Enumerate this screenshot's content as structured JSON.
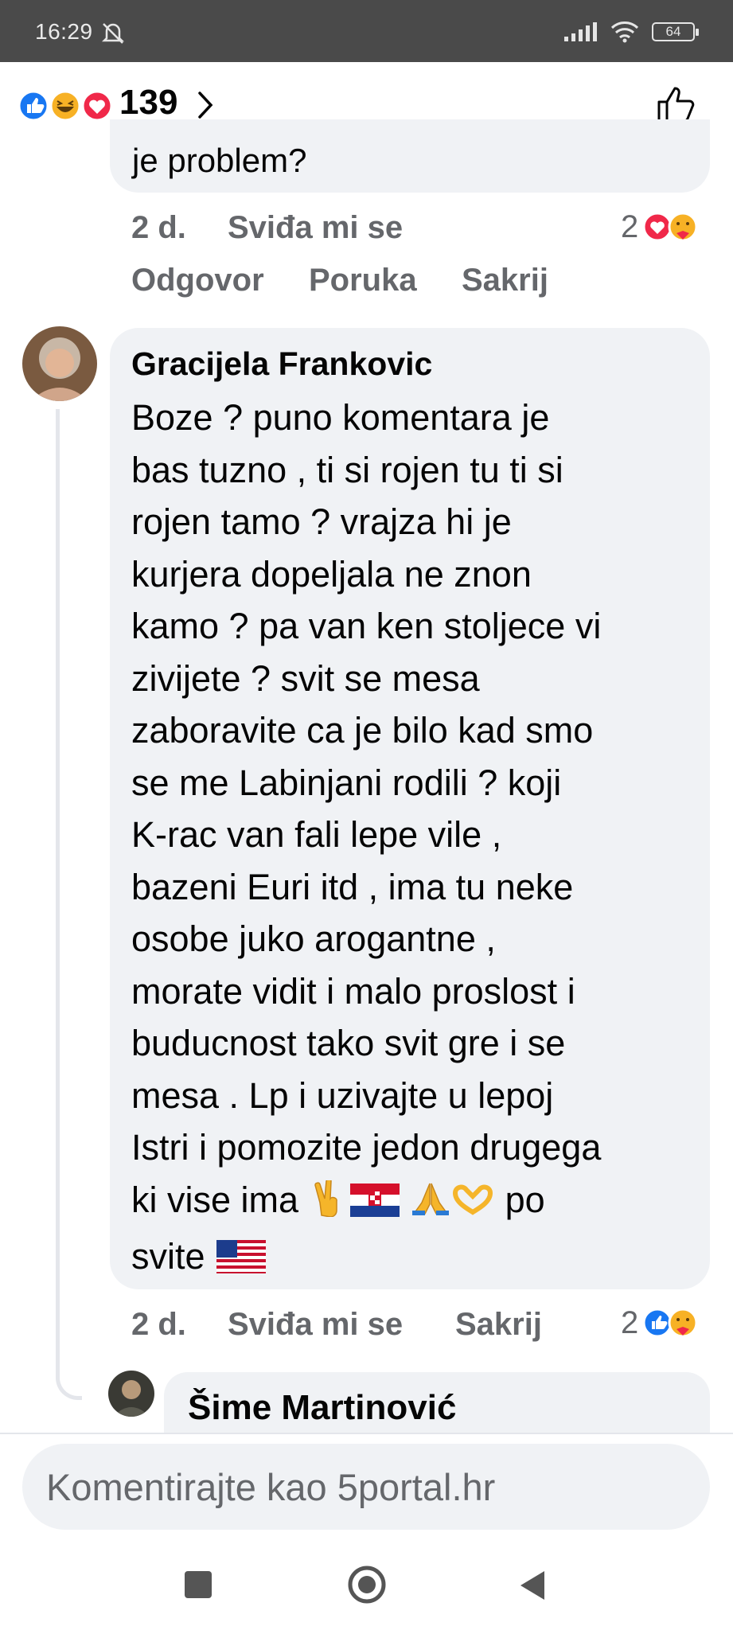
{
  "status_bar": {
    "time": "16:29",
    "battery": "64"
  },
  "reactions": {
    "count": "139",
    "icons": [
      "like-reaction",
      "haha-reaction",
      "love-reaction"
    ]
  },
  "comments": [
    {
      "text_tail": "je problem?",
      "time": "2 d.",
      "like_label": "Sviđa mi se",
      "reply_label": "Odgovor",
      "message_label": "Poruka",
      "hide_label": "Sakrij",
      "reaction_count": "2",
      "reaction_icons": [
        "love-reaction",
        "care-reaction"
      ]
    },
    {
      "author": "Gracijela Frankovic",
      "text_before_emoji": "Boze ? puno komentara je\nbas tuzno , ti si rojen tu ti si\nrojen  tamo ? vrajza hi je\nkurjera dopeljala ne znon\nkamo ? pa van ken stoljece vi\nzivijete ? svit se mesa\nzaboravite ca je bilo kad smo\nse me Labinjani rodili ? koji\nK-rac van fali lepe vile ,\nbazeni Euri itd , ima tu neke\nosobe juko arogantne ,\nmorate vidit i malo proslost i\nbuducnost tako svit gre i se\nmesa . Lp i uzivajte u lepoj\nIstri i pomozite jedon drugega\nki vise ima ",
      "text_middle": " po\nsvite ",
      "emojis": [
        "victory-hand",
        "croatia-flag",
        "folded-hands",
        "heart-hands",
        "usa-flag"
      ],
      "time": "2 d.",
      "like_label": "Sviđa mi se",
      "hide_label": "Sakrij",
      "reaction_count": "2",
      "reaction_icons": [
        "like-reaction",
        "care-reaction"
      ]
    },
    {
      "author": "Šime Martinović"
    }
  ],
  "composer": {
    "placeholder": "Komentirajte kao 5portal.hr"
  },
  "colors": {
    "meta_text": "#65676b",
    "bubble": "#f0f2f5",
    "like_blue": "#1877f2",
    "love_red": "#f02849"
  }
}
